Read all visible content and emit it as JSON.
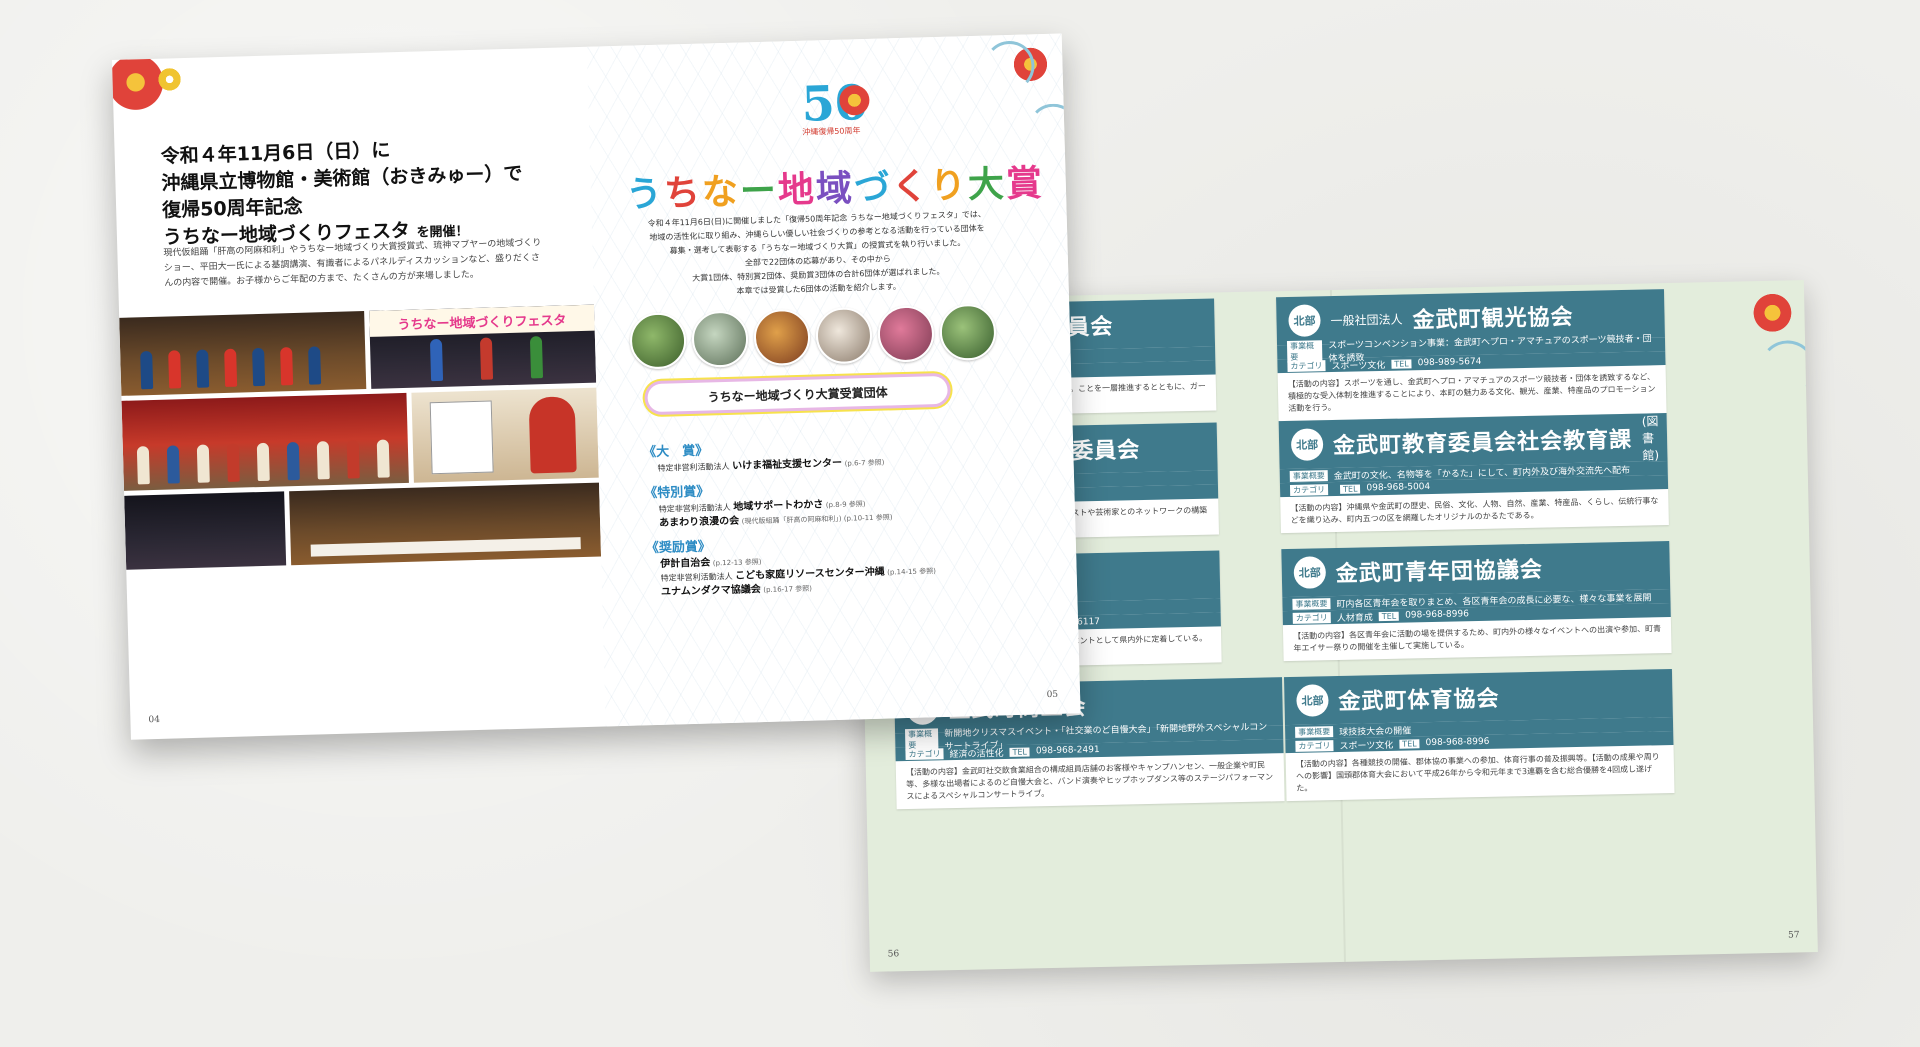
{
  "front_spread": {
    "left_page": {
      "headline_lines": [
        "令和４年11月6日（日）に",
        "沖縄県立博物館・美術館（おきみゅー）で",
        "復帰50周年記念",
        "うちなー地域づくりフェスタ"
      ],
      "headline_suffix": "を開催！",
      "lead_text": "現代仮組踊「肝高の阿麻和利」やうちなー地域づくり大賞授賞式、琉神マブヤーの地域づくりショー、平田大一氏による基調講演、有識者によるパネルディスカッションなど、盛りだくさんの内容で開催。お子様からご年配の方まで、たくさんの方が来場しました。",
      "festa_banner": "うちなー地域づくりフェスタ",
      "page_number": "04"
    },
    "right_page": {
      "logo_number": "50",
      "logo_caption": "沖縄復帰50周年",
      "award_title": "うちなー地域づくり大賞",
      "intro_lines": [
        "令和４年11月6日(日)に開催しました「復帰50周年記念 うちなー地域づくりフェスタ」では、",
        "地域の活性化に取り組み、沖縄らしい優しい社会づくりの参考となる活動を行っている団体を",
        "募集・選考して表彰する「うちなー地域づくり大賞」の授賞式を執り行いました。",
        "全部で22団体の応募があり、その中から",
        "大賞1団体、特別賞2団体、奨励賞3団体の合計6団体が選ばれました。",
        "本章では受賞した6団体の活動を紹介します。"
      ],
      "banner": "うちなー地域づくり大賞受賞団体",
      "categories": [
        {
          "name": "《大　賞》",
          "entries": [
            {
              "prefix": "特定非営利活動法人",
              "org": "いけま福祉支援センター",
              "ref": "(p.6-7 参照)"
            }
          ]
        },
        {
          "name": "《特別賞》",
          "entries": [
            {
              "prefix": "特定非営利活動法人",
              "org": "地域サポートわかさ",
              "ref": "(p.8-9 参照)"
            },
            {
              "prefix": "",
              "org": "あまわり浪漫の会",
              "ref": "(現代版組踊「肝高の阿麻和利」) (p.10-11 参照)"
            }
          ]
        },
        {
          "name": "《奨励賞》",
          "entries": [
            {
              "prefix": "",
              "org": "伊計自治会",
              "ref": "(p.12-13 参照)"
            },
            {
              "prefix": "特定非営利活動法人",
              "org": "こども家庭リソースセンター沖縄",
              "ref": "(p.14-15 参照)"
            },
            {
              "prefix": "",
              "org": "ユナムンダクマ協議会",
              "ref": "(p.16-17 参照)"
            }
          ]
        }
      ],
      "page_number": "05"
    }
  },
  "back_spread": {
    "cards": [
      {
        "badge": "",
        "prefix": "",
        "title": "ープンガーデン実行委員会",
        "tel_label": "TEL",
        "tel": "098-968-5125",
        "row1": "による景観美化及び観光振興",
        "row2": "観光交流",
        "body": "に付属するパンフレットに村内の観光資源及び飲食店情報を掲載。ことを一層推進するとともに、ガーデニングをする家庭が増え続"
      },
      {
        "badge": "北部",
        "prefix": "一般社団法人",
        "title": "金武町観光協会",
        "tel_label": "TEL",
        "tel": "098-989-5674",
        "row1": "スポーツコンベンション事業：金武町へプロ・アマチュアのスポーツ競技者・団体を誘致",
        "row2": "スポーツ文化",
        "body": "【活動の内容】スポーツを通し、金武町へプロ・アマチュアのスポーツ競技者・団体を誘致するなど、積極的な受入体制を推進することにより、本町の魅力ある文化、観光、産業、特産品のプロモーション活動を行う。"
      },
      {
        "badge": "",
        "prefix": "",
        "title": "のまちづくり事業実行委員会",
        "tel_label": "TEL",
        "tel": "098-968-5125",
        "row1": "スポーツ文化／観光交流／人材育成",
        "row2": "",
        "body": "の機会の確保や、文化を通した交流の機会を提供する。アーティストや芸術家とのネットワークの構築ができ、ホールでの公演、"
      },
      {
        "badge": "北部",
        "prefix": "",
        "title": "金武町教育委員会社会教育課",
        "title_suffix": "(図書館)",
        "tel_label": "TEL",
        "tel": "098-968-5004",
        "row1": "金武町の文化、名物等を「かるた」にして、町内外及び海外交流先へ配布",
        "row2": "",
        "body": "【活動の内容】沖縄県や金武町の歴史、民俗、文化、人物、自然、産業、特産品、くらし、伝統行事などを織り込み、町内五つの区を網羅したオリジナルのかるたである。"
      },
      {
        "badge": "",
        "prefix": "",
        "title": "ズムネットワーク",
        "tel_label": "TEL",
        "tel": "098-968-6117",
        "row1": "イベント「金武町たんぼフェスタ」",
        "row2": "づくり／観光交流／人材育成",
        "body": "【活動の成果や周りへの影響】毎年、5000名以上が参加するイベントとして県内外に定着している。本町の人口の約半数が1日で来町して当時の地域を賑わせる。"
      },
      {
        "badge": "北部",
        "prefix": "",
        "title": "金武町青年団協議会",
        "tel_label": "TEL",
        "tel": "098-968-8996",
        "row1": "町内各区青年会を取りまとめ、各区青年会の成長に必要な、様々な事業を展開",
        "row2": "人材育成",
        "body": "【活動の内容】各区青年会に活動の場を提供するため、町内外の様々なイベントへの出演や参加、町青年エイサー祭りの開催を主催して実施している。"
      },
      {
        "badge": "北部",
        "prefix": "",
        "title": "金武町商工会",
        "tel_label": "TEL",
        "tel": "098-968-2491",
        "row1": "新開地クリスマスイベント・「社交業のど自慢大会」「新開地野外スペシャルコンサートライブ」",
        "row2": "経済の活性化",
        "body": "【活動の内容】金武町社交飲食業組合の構成組員店舗のお客様やキャンプハンセン、一般企業や町民等、多様な出場者によるのど自慢大会と、バンド演奏やヒップホップダンス等のステージパフォーマンスによるスペシャルコンサートライブ。"
      },
      {
        "badge": "北部",
        "prefix": "",
        "title": "金武町体育協会",
        "tel_label": "TEL",
        "tel": "098-968-8996",
        "row1": "球技技大会の開催",
        "row2": "スポーツ文化",
        "body": "【活動の内容】各種競技の開催、郡体協の事業への参加、体育行事の普及振興等。【活動の成果や周りへの影響】国頭郡体育大会において平成26年から令和元年まで3連覇を含む総合優勝を4回成し遂げた。"
      }
    ],
    "labels": {
      "jigyo": "事業概要",
      "category": "カテゴリ"
    },
    "page_left": "56",
    "page_right": "57"
  }
}
